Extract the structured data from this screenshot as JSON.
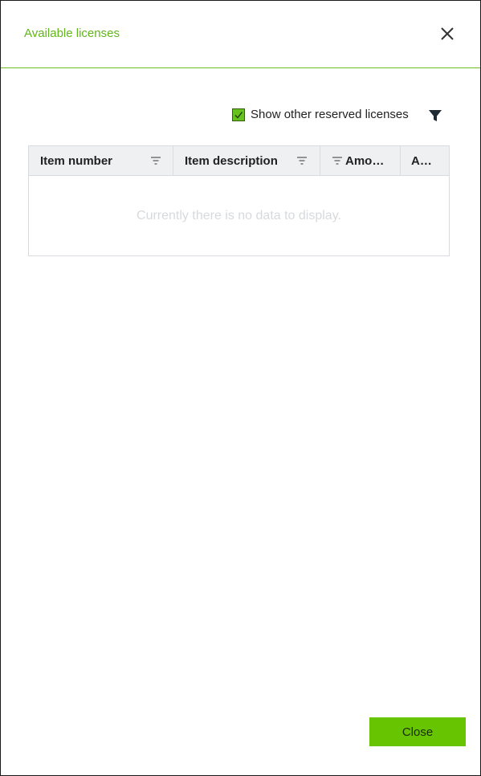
{
  "dialog": {
    "title": "Available licenses",
    "close_icon": "close-icon"
  },
  "toolbar": {
    "show_reserved_label": "Show other reserved licenses",
    "show_reserved_checked": true,
    "filter_icon": "funnel-icon"
  },
  "grid": {
    "columns": [
      {
        "label": "Item number",
        "icon": "sort-lines-icon"
      },
      {
        "label": "Item description",
        "icon": "sort-lines-icon"
      },
      {
        "label": "Amo…",
        "icon": "sort-lines-icon"
      },
      {
        "label": "A…"
      }
    ],
    "empty_message": "Currently there is no data to display."
  },
  "footer": {
    "close_label": "Close"
  },
  "colors": {
    "accent": "#66c500",
    "title": "#62b51a",
    "header_bg": "#eef0f2"
  }
}
